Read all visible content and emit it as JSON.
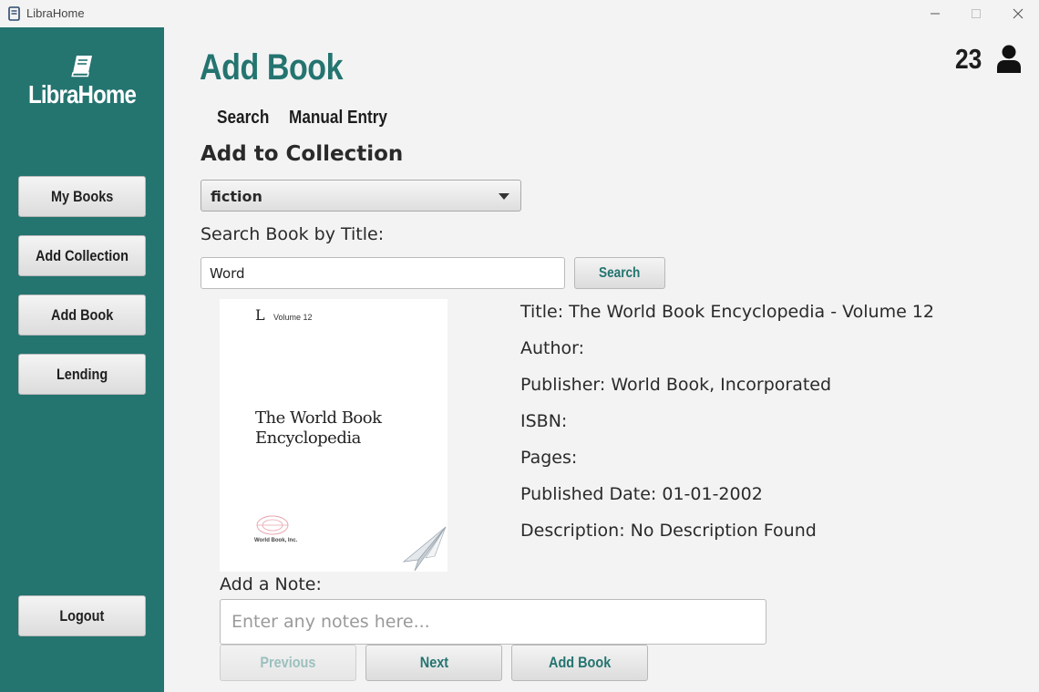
{
  "window": {
    "title": "LibraHome"
  },
  "sidebar": {
    "logo_text": "LibraHome",
    "items": [
      {
        "label": "My Books"
      },
      {
        "label": "Add Collection"
      },
      {
        "label": "Add Book"
      },
      {
        "label": "Lending"
      }
    ],
    "logout_label": "Logout"
  },
  "header": {
    "title": "Add Book",
    "count": "23"
  },
  "tabs": [
    {
      "label": "Search"
    },
    {
      "label": "Manual Entry"
    }
  ],
  "collection": {
    "label": "Add to Collection",
    "selected": "fiction"
  },
  "search": {
    "label": "Search Book by Title:",
    "value": "Word",
    "button_label": "Search"
  },
  "cover": {
    "letter": "L",
    "volume": "Volume 12",
    "title_line1": "The World Book",
    "title_line2": "Encyclopedia",
    "publisher": "World Book, Inc."
  },
  "details": {
    "title": "Title: The World Book Encyclopedia - Volume 12",
    "author": "Author:",
    "publisher": "Publisher: World Book, Incorporated",
    "isbn": "ISBN:",
    "pages": "Pages:",
    "published_date": "Published Date: 01-01-2002",
    "description": "Description: No Description Found"
  },
  "note": {
    "label": "Add a Note:",
    "placeholder": "Enter any notes here...",
    "value": ""
  },
  "actions": {
    "previous_label": "Previous",
    "next_label": "Next",
    "add_label": "Add Book"
  },
  "colors": {
    "accent": "#247470",
    "disabled_text": "#9cc0be",
    "background": "#f3f3f3"
  }
}
